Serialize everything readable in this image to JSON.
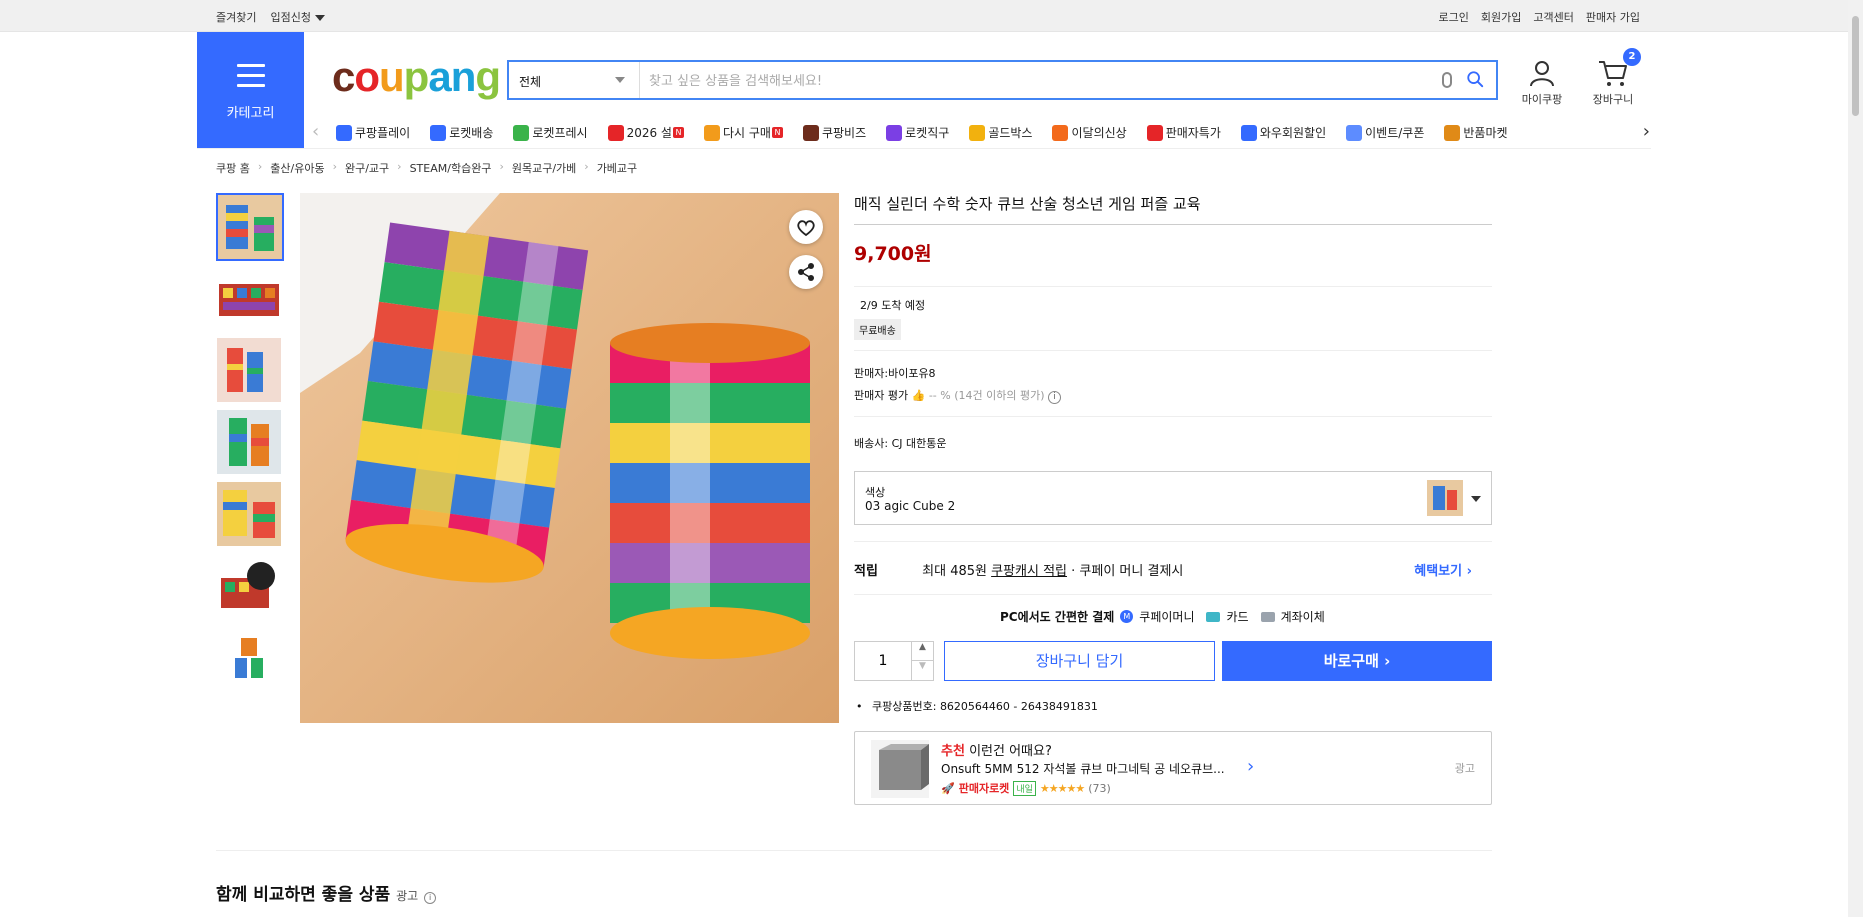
{
  "topbar": {
    "left": [
      "즐겨찾기",
      "입점신청"
    ],
    "right": [
      "로그인",
      "회원가입",
      "고객센터",
      "판매자 가입"
    ]
  },
  "header": {
    "category_label": "카테고리",
    "logo_text": [
      "c",
      "o",
      "u",
      "p",
      "a",
      "n",
      "g"
    ],
    "search_scope": "전체",
    "search_placeholder": "찾고 싶은 상품을 검색해보세요!",
    "mycoupang_label": "마이쿠팡",
    "cart_label": "장바구니",
    "cart_count": "2"
  },
  "nav": {
    "items": [
      {
        "label": "쿠팡플레이",
        "icon": "play-icon",
        "color": "#346aff"
      },
      {
        "label": "로켓배송",
        "icon": "rocket-icon",
        "color": "#346aff"
      },
      {
        "label": "로켓프레시",
        "icon": "rocket-fresh-icon",
        "color": "#3ab34a"
      },
      {
        "label": "2026 설",
        "icon": "seollal-icon",
        "color": "#e52528",
        "badge": "N"
      },
      {
        "label": "다시 구매",
        "icon": "rebuy-icon",
        "color": "#f29b1b",
        "badge": "N"
      },
      {
        "label": "쿠팡비즈",
        "icon": "biz-icon",
        "color": "#6d2c1c",
        "prefix": "biz"
      },
      {
        "label": "로켓직구",
        "icon": "global-rocket-icon",
        "color": "#7b3fe4"
      },
      {
        "label": "골드박스",
        "icon": "goldbox-icon",
        "color": "#f2b10e"
      },
      {
        "label": "이달의신상",
        "icon": "new-bag-icon",
        "color": "#f36a1c"
      },
      {
        "label": "판매자특가",
        "icon": "seller-deal-icon",
        "color": "#e52528"
      },
      {
        "label": "와우회원할인",
        "icon": "wow-icon",
        "color": "#346aff"
      },
      {
        "label": "이벤트/쿠폰",
        "icon": "coupon-icon",
        "color": "#5d8cff"
      },
      {
        "label": "반품마켓",
        "icon": "return-market-icon",
        "color": "#e08a17"
      }
    ]
  },
  "breadcrumb": [
    "쿠팡 홈",
    "출산/유아동",
    "완구/교구",
    "STEAM/학습완구",
    "원목교구/가베",
    "가베교구"
  ],
  "product": {
    "title": "매직 실린더 수학 숫자 큐브 산술 청소년 게임 퍼즐 교육",
    "price": "9,700원",
    "arrival": "2/9 도착 예정",
    "shipping_badge": "무료배송",
    "seller_label": "판매자:",
    "seller_name": "바이포유8",
    "rating_label": "판매자 평가",
    "rating_text": "-- % (14건 이하의 평가)",
    "courier_label": "배송사:",
    "courier_name": "CJ 대한통운",
    "option_label": "색상",
    "option_value": "03 agic Cube 2",
    "reward_label": "적립",
    "reward_text_prefix": "최대 485원",
    "reward_link": "쿠팡캐시 적립",
    "reward_text_suffix": "· 쿠페이 머니 결제시",
    "benefit_link": "혜택보기",
    "pay_title": "PC에서도 간편한 결제",
    "pay_methods": [
      "쿠페이머니",
      "카드",
      "계좌이체"
    ],
    "quantity": "1",
    "cart_button": "장바구니 담기",
    "buy_button": "바로구매",
    "product_number_label": "쿠팡상품번호:",
    "product_number": "8620564460 - 26438491831"
  },
  "recommendation": {
    "title_highlight": "추천",
    "title_rest": "이런건 어때요?",
    "item_name": "Onsuft 5MM 512 자석볼 큐브 마그네틱 공 네오큐브...",
    "rocket_label": "판매자로켓",
    "delivery_tag": "내일",
    "stars": 4.5,
    "review_count": "(73)",
    "ad_label": "광고"
  },
  "compare": {
    "title": "함께 비교하면 좋을 상품",
    "ad_label": "광고"
  },
  "colors": {
    "accent": "#346aff",
    "price": "#ae0000",
    "recommend": "#e52528"
  }
}
